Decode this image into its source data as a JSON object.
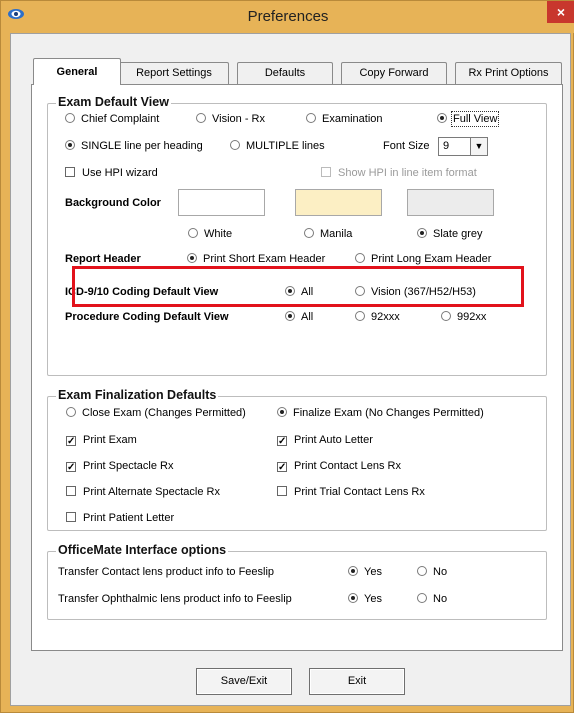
{
  "window": {
    "title": "Preferences",
    "close_glyph": "×",
    "accent": "#e7b357",
    "close_color": "#c8372d"
  },
  "tabs": [
    "General",
    "Report Settings",
    "Defaults",
    "Copy Forward",
    "Rx Print Options"
  ],
  "active_tab": "General",
  "exam_default_view": {
    "title": "Exam Default View",
    "view_options": [
      "Chief Complaint",
      "Vision - Rx",
      "Examination",
      "Full View"
    ],
    "view_selected": "Full View",
    "line_options": [
      "SINGLE line per heading",
      "MULTIPLE lines"
    ],
    "line_selected": "SINGLE line per heading",
    "font_size_label": "Font Size",
    "font_size_value": "9",
    "use_hpi_label": "Use HPI wizard",
    "show_hpi_label": "Show HPI in line item format",
    "background_color_label": "Background Color",
    "background_options": [
      "White",
      "Manila",
      "Slate grey"
    ],
    "background_selected": "Slate grey",
    "background_swatches": [
      "#ffffff",
      "#fcefc4",
      "#ececec"
    ],
    "report_header_label": "Report Header",
    "report_header_options": [
      "Print Short Exam Header",
      "Print Long Exam Header"
    ],
    "report_header_selected": "Print Short Exam Header",
    "icd_label": "ICD-9/10 Coding Default View",
    "icd_options": [
      "All",
      "Vision (367/H52/H53)"
    ],
    "icd_selected": "All",
    "procedure_label": "Procedure Coding Default View",
    "procedure_options": [
      "All",
      "92xxx",
      "992xx"
    ],
    "procedure_selected": "All"
  },
  "exam_finalization": {
    "title": "Exam Finalization Defaults",
    "close_options": [
      "Close Exam (Changes Permitted)",
      "Finalize Exam (No Changes Permitted)"
    ],
    "close_selected": "Finalize Exam (No Changes Permitted)",
    "checks": [
      {
        "label": "Print Exam",
        "checked": true
      },
      {
        "label": "Print Auto Letter",
        "checked": true
      },
      {
        "label": "Print Spectacle Rx",
        "checked": true
      },
      {
        "label": "Print Contact Lens Rx",
        "checked": true
      },
      {
        "label": "Print Alternate Spectacle Rx",
        "checked": false
      },
      {
        "label": "Print Trial Contact Lens Rx",
        "checked": false
      },
      {
        "label": "Print Patient Letter",
        "checked": false
      }
    ]
  },
  "officemate": {
    "title": "OfficeMate Interface options",
    "rows": [
      {
        "label": "Transfer Contact lens product info to Feeslip",
        "yes": "Yes",
        "no": "No",
        "selected": "Yes"
      },
      {
        "label": "Transfer Ophthalmic lens product info to Feeslip",
        "yes": "Yes",
        "no": "No",
        "selected": "Yes"
      }
    ]
  },
  "buttons": {
    "save_exit": "Save/Exit",
    "exit": "Exit"
  },
  "checkmark_glyph": "✓",
  "dropdown_glyph": "▼"
}
